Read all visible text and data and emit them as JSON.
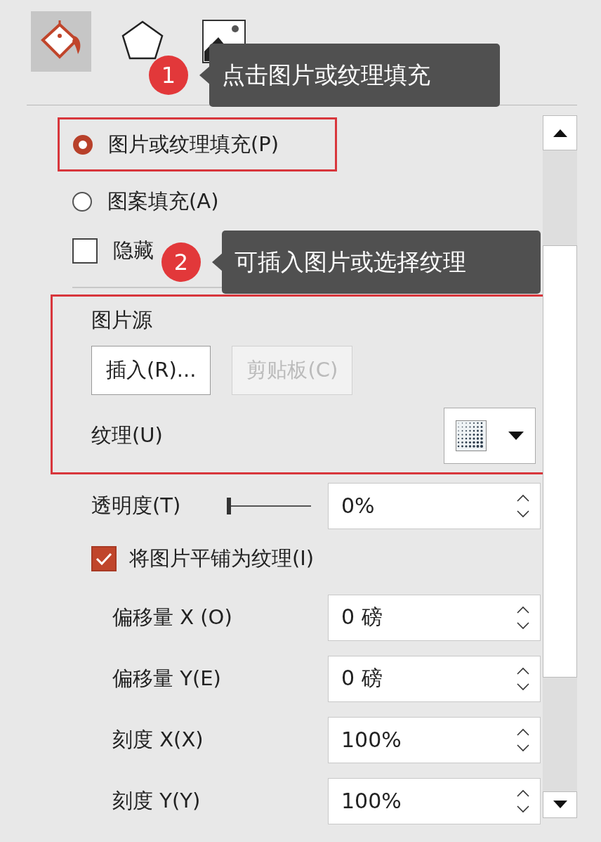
{
  "tabs": [
    {
      "kind": "fill",
      "selected": true
    },
    {
      "kind": "shape",
      "selected": false
    },
    {
      "kind": "picture",
      "selected": false
    }
  ],
  "callouts": [
    {
      "number": "1",
      "text": "点击图片或纹理填充"
    },
    {
      "number": "2",
      "text": "可插入图片或选择纹理"
    }
  ],
  "fill_options": [
    {
      "kind": "radio",
      "label": "图片或纹理填充(P)",
      "selected": true,
      "highlighted": true
    },
    {
      "kind": "radio",
      "label": "图案填充(A)",
      "selected": false,
      "highlighted": false
    },
    {
      "kind": "checkbox",
      "label": "隐藏",
      "checked": false,
      "highlighted": false
    }
  ],
  "picture_source": {
    "title": "图片源",
    "highlighted": true,
    "buttons": [
      {
        "label": "插入(R)...",
        "disabled": false
      },
      {
        "label": "剪贴板(C)",
        "disabled": true
      }
    ],
    "texture_label": "纹理(U)"
  },
  "transparency": {
    "label": "透明度(T)",
    "level": 0,
    "value": "0%"
  },
  "tile": {
    "label": "将图片平铺为纹理(I)",
    "checked": true
  },
  "fields": [
    {
      "label": "偏移量 X (O)",
      "value": "0 磅"
    },
    {
      "label": "偏移量 Y(E)",
      "value": "0 磅"
    },
    {
      "label": "刻度 X(X)",
      "value": "100%"
    },
    {
      "label": "刻度 Y(Y)",
      "value": "100%"
    }
  ]
}
